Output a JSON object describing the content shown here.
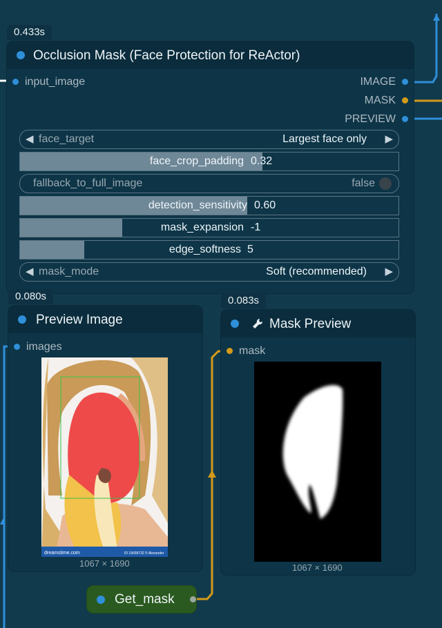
{
  "colors": {
    "background": "#123a4d",
    "node_body": "#0d3547",
    "node_header": "#0a2c3c",
    "image_wire": "#2f8fd9",
    "mask_wire": "#d49a1a",
    "get_node": "#2a5a1f"
  },
  "occlusion_node": {
    "timing": "0.433s",
    "title": "Occlusion Mask (Face Protection for ReActor)",
    "input": "input_image",
    "outputs": [
      "IMAGE",
      "MASK",
      "PREVIEW"
    ],
    "widgets": {
      "face_target": {
        "label": "face_target",
        "value": "Largest face only"
      },
      "face_crop_padding": {
        "label": "face_crop_padding",
        "value": "0.32",
        "fill": 0.64
      },
      "fallback_to_full_image": {
        "label": "fallback_to_full_image",
        "value": "false"
      },
      "detection_sensitivity": {
        "label": "detection_sensitivity",
        "value": "0.60",
        "fill": 0.6
      },
      "mask_expansion": {
        "label": "mask_expansion",
        "value": "-1",
        "fill": 0.27
      },
      "edge_softness": {
        "label": "edge_softness",
        "value": "5",
        "fill": 0.17
      },
      "mask_mode": {
        "label": "mask_mode",
        "value": "Soft (recommended)"
      }
    }
  },
  "preview_node": {
    "timing": "0.080s",
    "title": "Preview Image",
    "input": "images",
    "caption": "1067 × 1690",
    "watermark_left": "dreamstime.com",
    "watermark_right": "ID 19658732 © Alexander"
  },
  "mask_node": {
    "timing": "0.083s",
    "title": "Mask Preview",
    "icon": "wrench-icon",
    "input": "mask",
    "caption": "1067 × 1690"
  },
  "get_node": {
    "title": "Get_mask"
  }
}
